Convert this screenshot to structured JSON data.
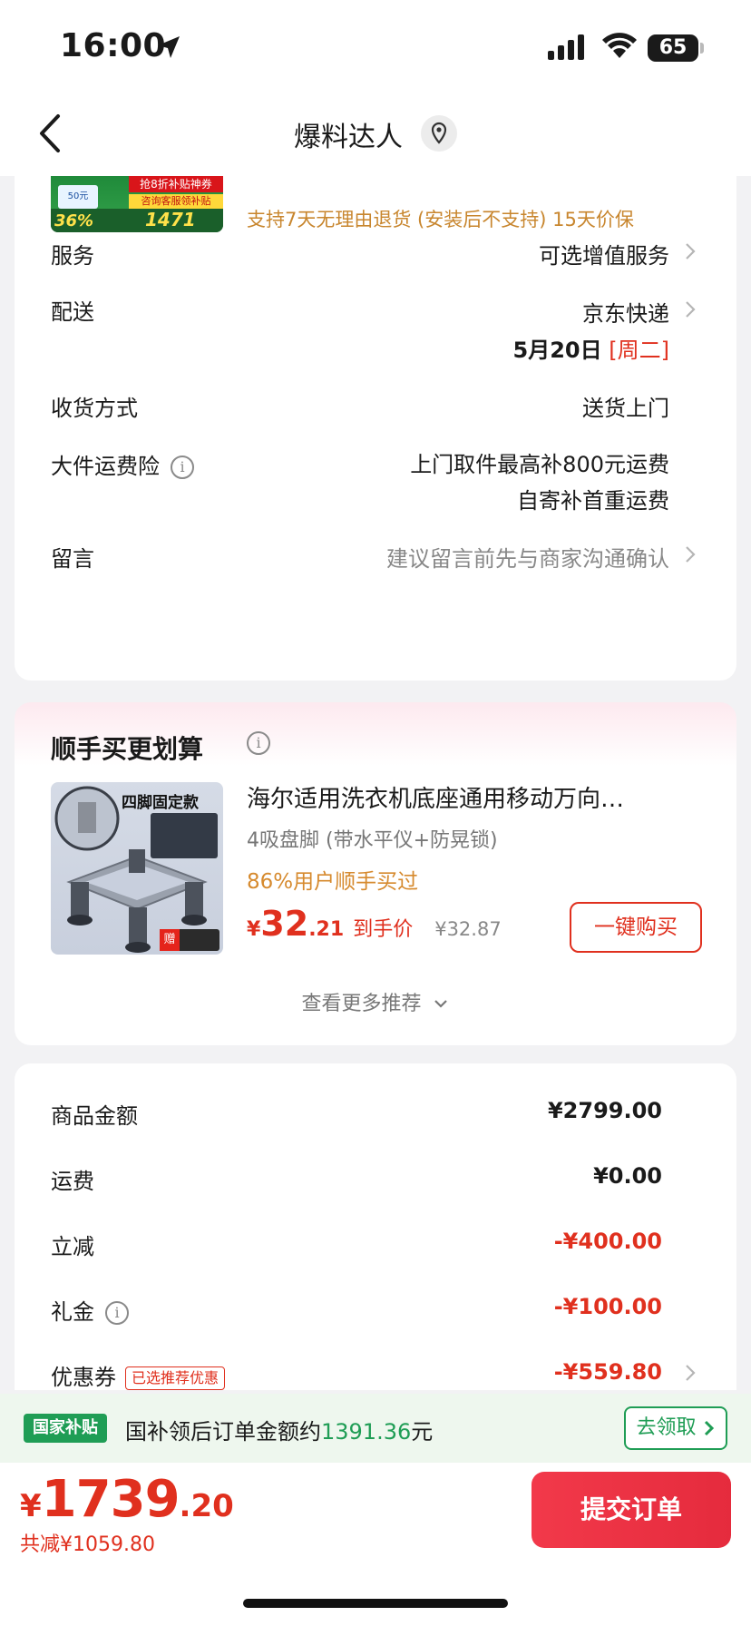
{
  "status_bar": {
    "time": "16:00",
    "battery": "65"
  },
  "nav": {
    "title": "爆料达人"
  },
  "promo": {
    "tag_top": "抢8折补贴神券",
    "tag_service": "咨询客服领补贴",
    "box_text": "50元",
    "percent": "36%",
    "amount": "1471",
    "return_note": "支持7天无理由退货 (安装后不支持)   15天价保"
  },
  "order_rows": {
    "service": {
      "label": "服务",
      "value": "可选增值服务"
    },
    "delivery": {
      "label": "配送",
      "value": "京东快递",
      "date": "5月20日",
      "weekday": "[周二]"
    },
    "receive": {
      "label": "收货方式",
      "value": "送货上门"
    },
    "insurance": {
      "label": "大件运费险",
      "line1": "上门取件最高补800元运费",
      "line2": "自寄补首重运费"
    },
    "message": {
      "label": "留言",
      "placeholder": "建议留言前先与商家沟通确认"
    }
  },
  "recommend": {
    "title": "顺手买更划算",
    "product": {
      "image_title": "四脚固定款",
      "gift_label": "赠",
      "name": "海尔适用洗衣机底座通用移动万向…",
      "subtitle": "4吸盘脚 (带水平仪+防晃锁)",
      "bought": "86%用户顺手买过",
      "price_yen": "¥",
      "price_int": "32",
      "price_dec": ".21",
      "price_tag": "到手价",
      "price_orig": "¥32.87",
      "buy_label": "一键购买"
    },
    "more_label": "查看更多推荐"
  },
  "amounts": {
    "goods": {
      "label": "商品金额",
      "value": "¥2799.00"
    },
    "shipping": {
      "label": "运费",
      "value": "¥0.00"
    },
    "discount": {
      "label": "立减",
      "value": "-¥400.00"
    },
    "gift": {
      "label": "礼金",
      "value": "-¥100.00"
    },
    "coupon": {
      "label": "优惠券",
      "tag": "已选推荐优惠",
      "value": "-¥559.80"
    }
  },
  "subsidy": {
    "badge": "国家补贴",
    "text_prefix": "国补领后订单金额约",
    "amount": "1391.36",
    "text_suffix": "元",
    "button": "去领取"
  },
  "bottom": {
    "total_yen": "¥",
    "total_int": "1739",
    "total_dec": ".20",
    "saved": "共减¥1059.80",
    "submit": "提交订单"
  },
  "colors": {
    "accent_red": "#e0301e",
    "green": "#1f9d55",
    "orange": "#c8862e",
    "submit_red": "#f2394a"
  }
}
